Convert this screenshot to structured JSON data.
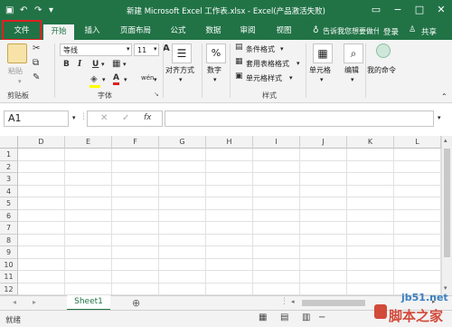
{
  "window": {
    "title": "新建 Microsoft Excel 工作表.xlsx - Excel(产品激活失败)"
  },
  "tabs": [
    "文件",
    "开始",
    "插入",
    "页面布局",
    "公式",
    "数据",
    "审阅",
    "视图"
  ],
  "tell_me": "告诉我您想要做什么",
  "account": {
    "login": "登录",
    "share": "共享"
  },
  "clipboard": {
    "paste": "粘贴",
    "group": "剪贴板"
  },
  "font": {
    "name": "等线",
    "size": "11",
    "bold": "B",
    "italic": "I",
    "underline": "U",
    "grow": "A",
    "shrink": "A",
    "color_letter": "A",
    "phonetic": "wén",
    "group": "字体"
  },
  "alignment": {
    "label": "对齐方式"
  },
  "number": {
    "label": "数字",
    "symbol": "%"
  },
  "styles": {
    "conditional": "条件格式",
    "table": "套用表格格式",
    "cell_styles": "单元格样式",
    "group": "样式"
  },
  "cells": {
    "label": "单元格"
  },
  "editing": {
    "label": "编辑"
  },
  "mycommands": {
    "label": "我的命令"
  },
  "formula_bar": {
    "namebox": "A1",
    "fx": "fx",
    "value": ""
  },
  "columns": [
    "D",
    "E",
    "F",
    "G",
    "H",
    "I",
    "J",
    "K",
    "L"
  ],
  "rows": [
    "1",
    "2",
    "3",
    "4",
    "5",
    "6",
    "7",
    "8",
    "9",
    "10",
    "11",
    "12"
  ],
  "sheets": {
    "active": "Sheet1",
    "add": "⊕"
  },
  "status": {
    "ready": "就绪"
  },
  "watermark": {
    "site": "jb51.net",
    "text": "脚本之家"
  },
  "colors": {
    "excel_green": "#217346",
    "highlight": "#e02020"
  }
}
